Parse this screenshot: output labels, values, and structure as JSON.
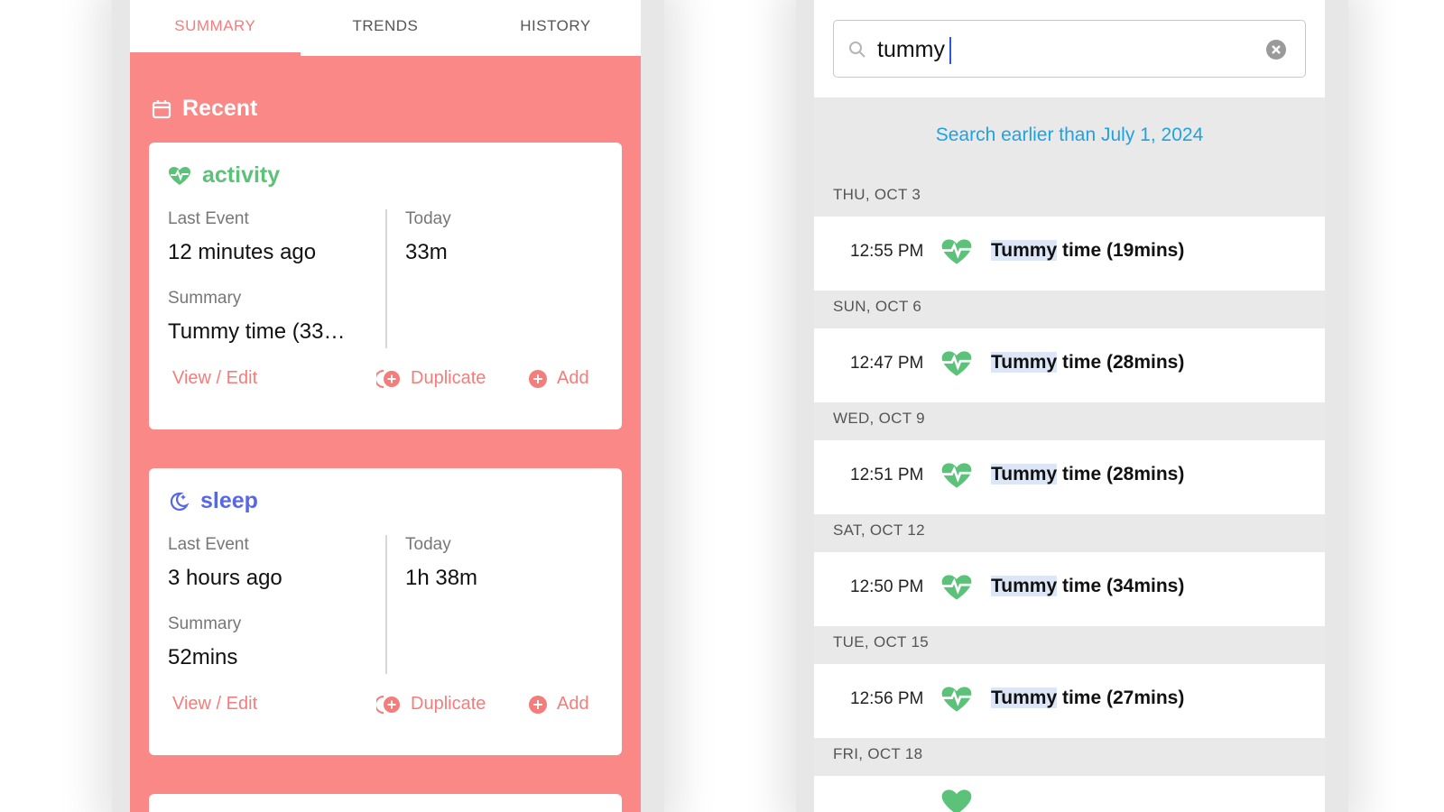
{
  "tabs": [
    {
      "label": "SUMMARY",
      "active": true
    },
    {
      "label": "TRENDS",
      "active": false
    },
    {
      "label": "HISTORY",
      "active": false
    }
  ],
  "recent": {
    "title": "Recent"
  },
  "cards": {
    "activity": {
      "title": "activity",
      "last_event_label": "Last Event",
      "last_event_value": "12 minutes ago",
      "today_label": "Today",
      "today_value": "33m",
      "summary_label": "Summary",
      "summary_value": "Tummy time (33…",
      "view_edit": "View / Edit",
      "duplicate": "Duplicate",
      "add": "Add"
    },
    "sleep": {
      "title": "sleep",
      "last_event_label": "Last Event",
      "last_event_value": "3 hours ago",
      "today_label": "Today",
      "today_value": "1h 38m",
      "summary_label": "Summary",
      "summary_value": "52mins",
      "view_edit": "View / Edit",
      "duplicate": "Duplicate",
      "add": "Add"
    }
  },
  "search": {
    "value": "tummy",
    "earlier_link": "Search earlier than July 1, 2024"
  },
  "results": [
    {
      "day": "THU, OCT 3",
      "time": "12:55 PM",
      "match": "Tummy",
      "rest": " time (19mins)"
    },
    {
      "day": "SUN, OCT 6",
      "time": "12:47 PM",
      "match": "Tummy",
      "rest": " time (28mins)"
    },
    {
      "day": "WED, OCT 9",
      "time": "12:51 PM",
      "match": "Tummy",
      "rest": " time (28mins)"
    },
    {
      "day": "SAT, OCT 12",
      "time": "12:50 PM",
      "match": "Tummy",
      "rest": " time (34mins)"
    },
    {
      "day": "TUE, OCT 15",
      "time": "12:56 PM",
      "match": "Tummy",
      "rest": " time (27mins)"
    },
    {
      "day": "FRI, OCT 18",
      "time": "",
      "match": "",
      "rest": ""
    }
  ],
  "colors": {
    "accent": "#f98886",
    "activity": "#5cc27a",
    "sleep": "#5668e3",
    "link": "#21a2df"
  }
}
